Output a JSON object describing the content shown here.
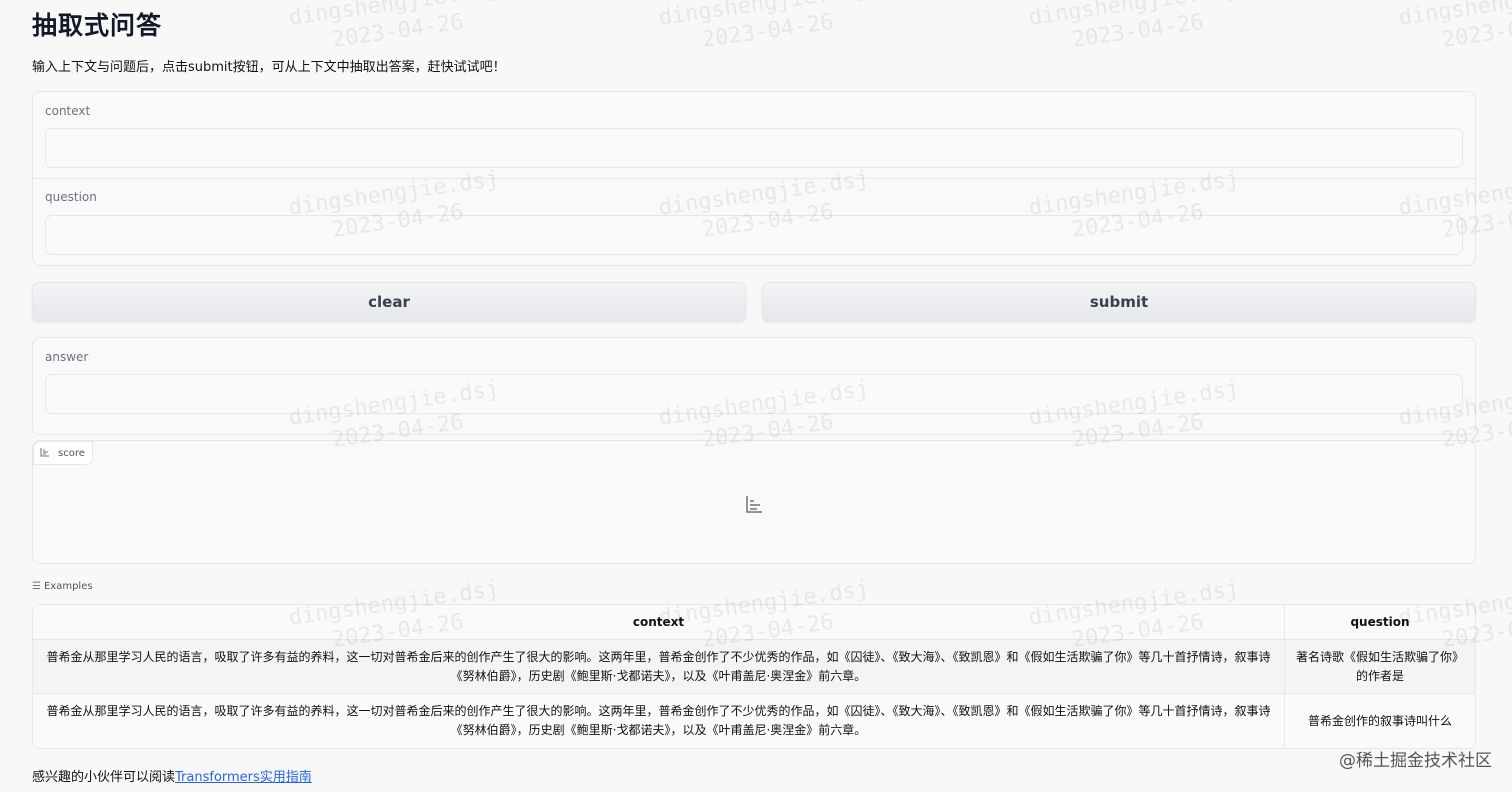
{
  "title": "抽取式问答",
  "description": "输入上下文与问题后，点击submit按钮，可从上下文中抽取出答案，赶快试试吧！",
  "inputs": {
    "context_label": "context",
    "context_value": "",
    "question_label": "question",
    "question_value": ""
  },
  "buttons": {
    "clear": "clear",
    "submit": "submit"
  },
  "outputs": {
    "answer_label": "answer",
    "answer_value": "",
    "score_label": "score"
  },
  "examples": {
    "label": "Examples",
    "headers": [
      "context",
      "question"
    ],
    "rows": [
      {
        "context": "普希金从那里学习人民的语言，吸取了许多有益的养料，这一切对普希金后来的创作产生了很大的影响。这两年里，普希金创作了不少优秀的作品，如《囚徒》、《致大海》、《致凯恩》和《假如生活欺骗了你》等几十首抒情诗，叙事诗《努林伯爵》，历史剧《鲍里斯·戈都诺夫》，以及《叶甫盖尼·奥涅金》前六章。",
        "question": "著名诗歌《假如生活欺骗了你》的作者是"
      },
      {
        "context": "普希金从那里学习人民的语言，吸取了许多有益的养料，这一切对普希金后来的创作产生了很大的影响。这两年里，普希金创作了不少优秀的作品，如《囚徒》、《致大海》、《致凯恩》和《假如生活欺骗了你》等几十首抒情诗，叙事诗《努林伯爵》，历史剧《鲍里斯·戈都诺夫》，以及《叶甫盖尼·奥涅金》前六章。",
        "question": "普希金创作的叙事诗叫什么"
      }
    ]
  },
  "footer": {
    "text": "感兴趣的小伙伴可以阅读",
    "link": "Transformers实用指南"
  },
  "watermark": {
    "name": "dingshengjie.dsj",
    "date": "2023-04-26"
  },
  "site_mark": "@稀土掘金技术社区",
  "icons": {
    "score": "bar-chart-icon",
    "examples": "list-icon"
  },
  "colors": {
    "link": "#2563eb",
    "background": "#f8f8f9",
    "border": "#e5e7eb"
  }
}
